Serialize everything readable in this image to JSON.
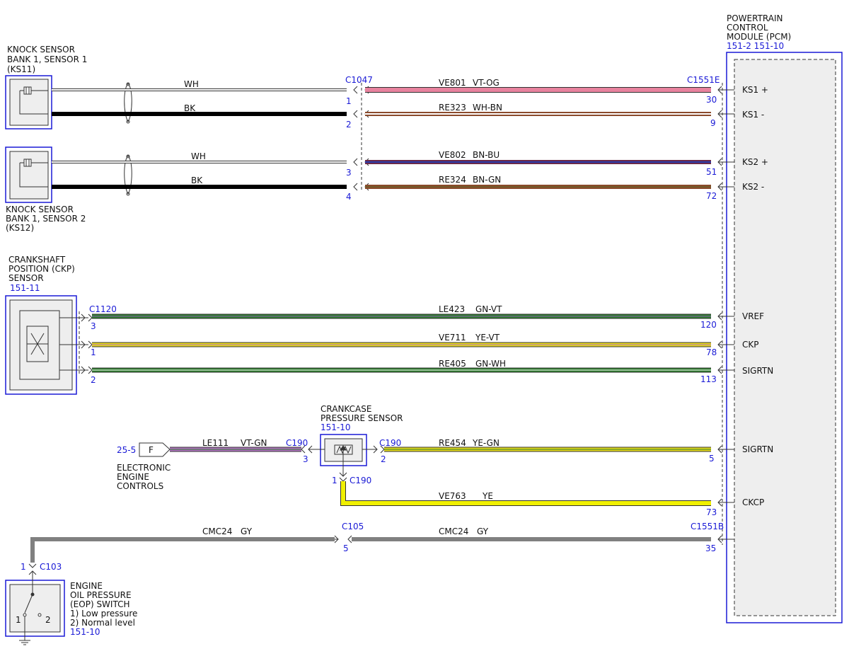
{
  "pcm": {
    "title_lines": [
      "POWERTRAIN",
      "CONTROL",
      "MODULE (PCM)"
    ],
    "ref": "151-2 151-10",
    "pins": {
      "ks1p": "KS1 +",
      "ks1n": "KS1 -",
      "ks2p": "KS2 +",
      "ks2n": "KS2 -",
      "vref": "VREF",
      "ckp": "CKP",
      "sigrtn1": "SIGRTN",
      "sigrtn2": "SIGRTN",
      "ckcp": "CKCP"
    }
  },
  "ks11": {
    "title_lines": [
      "KNOCK SENSOR",
      "BANK 1, SENSOR 1",
      "(KS11)"
    ]
  },
  "ks12": {
    "title_lines": [
      "KNOCK SENSOR",
      "BANK 1, SENSOR 2",
      "(KS12)"
    ]
  },
  "ckp_sensor": {
    "title_lines": [
      "CRANKSHAFT",
      "POSITION (CKP)",
      "SENSOR"
    ],
    "ref": "151-11"
  },
  "ccp_sensor": {
    "title_lines": [
      "CRANKCASE",
      "PRESSURE SENSOR"
    ],
    "ref": "151-10"
  },
  "eop_switch": {
    "title_lines": [
      "ENGINE",
      "OIL PRESSURE",
      "(EOP) SWITCH",
      "1) Low pressure",
      "2) Normal level"
    ],
    "ref": "151-10",
    "pin1": "1",
    "pin2": "2"
  },
  "ecc": {
    "ref": "25-5",
    "flag": "F",
    "title_lines": [
      "ELECTRONIC",
      "ENGINE",
      "CONTROLS"
    ]
  },
  "connectors": {
    "c1047": "C1047",
    "c1551e": "C1551E",
    "c1120": "C1120",
    "c190a": "C190",
    "c190b": "C190",
    "c190c": "C190",
    "c105": "C105",
    "c1551b": "C1551B",
    "c103": "C103"
  },
  "pins": {
    "c1047_1": "1",
    "c1047_2": "2",
    "c1047_3": "3",
    "c1047_4": "4",
    "pcm_30": "30",
    "pcm_9": "9",
    "pcm_51": "51",
    "pcm_72": "72",
    "c1120_3": "3",
    "c1120_1": "1",
    "c1120_2": "2",
    "pcm_120": "120",
    "pcm_78": "78",
    "pcm_113": "113",
    "c190_3": "3",
    "c190_2": "2",
    "c190_1": "1",
    "pcm_5": "5",
    "pcm_73": "73",
    "c105_5": "5",
    "pcm_35": "35",
    "c103_1": "1"
  },
  "wires": {
    "ks1_wh": "WH",
    "ks1_bk": "BK",
    "ks2_wh": "WH",
    "ks2_bk": "BK",
    "ve801": "VE801",
    "ve801_color": "VT-OG",
    "re323": "RE323",
    "re323_color": "WH-BN",
    "ve802": "VE802",
    "ve802_color": "BN-BU",
    "re324": "RE324",
    "re324_color": "BN-GN",
    "le423": "LE423",
    "le423_color": "GN-VT",
    "ve711": "VE711",
    "ve711_color": "YE-VT",
    "re405": "RE405",
    "re405_color": "GN-WH",
    "le111": "LE111",
    "le111_color": "VT-GN",
    "re454": "RE454",
    "re454_color": "YE-GN",
    "ve763": "VE763",
    "ve763_color": "YE",
    "cmc24a": "CMC24",
    "cmc24a_color": "GY",
    "cmc24b": "CMC24",
    "cmc24b_color": "GY"
  },
  "colors": {
    "outline_blue": "#1a1ad6",
    "wire_pink": "#e8829e",
    "wire_black": "#000000",
    "wire_wh_bn": "#e8c9c0",
    "wire_bn_bu": "#6b2a4a",
    "wire_brown": "#8b4a2b",
    "wire_green": "#2e7d2e",
    "wire_yellow": "#e6d81a",
    "wire_yellow_green": "#c8d628",
    "wire_violet": "#b070c0",
    "wire_yellow_solid": "#f0f000",
    "wire_gray": "#808080",
    "module_fill": "#eeeeee"
  }
}
